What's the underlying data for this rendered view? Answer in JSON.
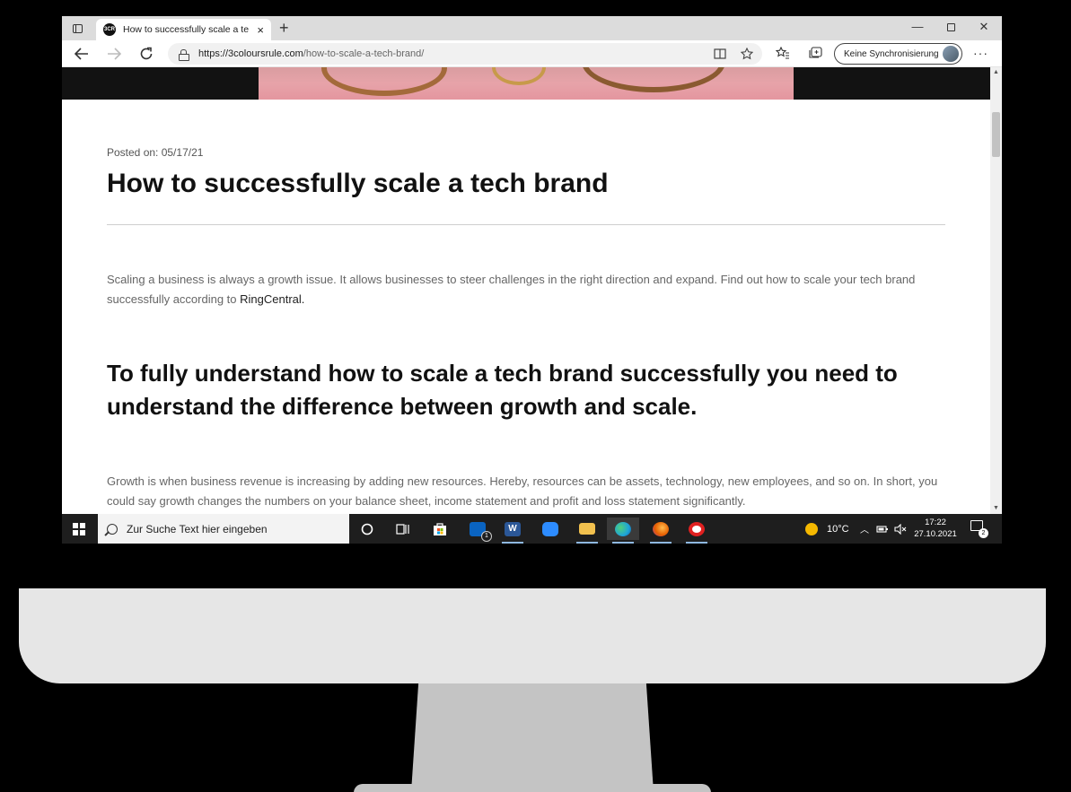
{
  "browser": {
    "tab_title": "How to successfully scale a tech",
    "favicon_text": "3CR",
    "close_tab_glyph": "×",
    "new_tab_glyph": "+",
    "url_domain": "https://3coloursrule.com",
    "url_path": "/how-to-scale-a-tech-brand/",
    "sync_label": "Keine Synchronisierung",
    "more_glyph": "···",
    "window_controls": {
      "minimize": "—",
      "close": "✕"
    }
  },
  "article": {
    "posted_on": "Posted on: 05/17/21",
    "title": "How to successfully scale a tech brand",
    "intro_text": "Scaling a business is always a growth issue. It allows businesses to steer challenges in the right direction and expand. Find out how to scale your tech brand successfully according to ",
    "intro_link": "RingCentral.",
    "heading": "To fully understand how to scale a tech brand successfully you need to understand the difference between growth and scale.",
    "growth_text": "Growth is when business revenue is increasing by adding new resources. Hereby, resources can be assets, technology, new employees, and so on. In short, you could say growth changes the numbers on your balance sheet, income statement and profit and loss statement significantly."
  },
  "taskbar": {
    "search_placeholder": "Zur Suche Text hier eingeben",
    "mail_badge": "1",
    "temperature": "10°C",
    "time": "17:22",
    "date": "27.10.2021",
    "notification_count": "2",
    "apps": [
      {
        "name": "cortana-icon"
      },
      {
        "name": "task-view-icon"
      },
      {
        "name": "store-icon",
        "color": "#ffffff"
      },
      {
        "name": "mail-icon",
        "color": "#0a64c2"
      },
      {
        "name": "word-icon",
        "color": "#2b5797"
      },
      {
        "name": "zoom-icon",
        "color": "#2d8cff"
      },
      {
        "name": "file-explorer-icon",
        "color": "#f2c14e"
      },
      {
        "name": "edge-icon",
        "color": "#1ea4d8"
      },
      {
        "name": "firefox-icon",
        "color": "#e66000"
      },
      {
        "name": "opera-icon",
        "color": "#e02020"
      }
    ]
  }
}
